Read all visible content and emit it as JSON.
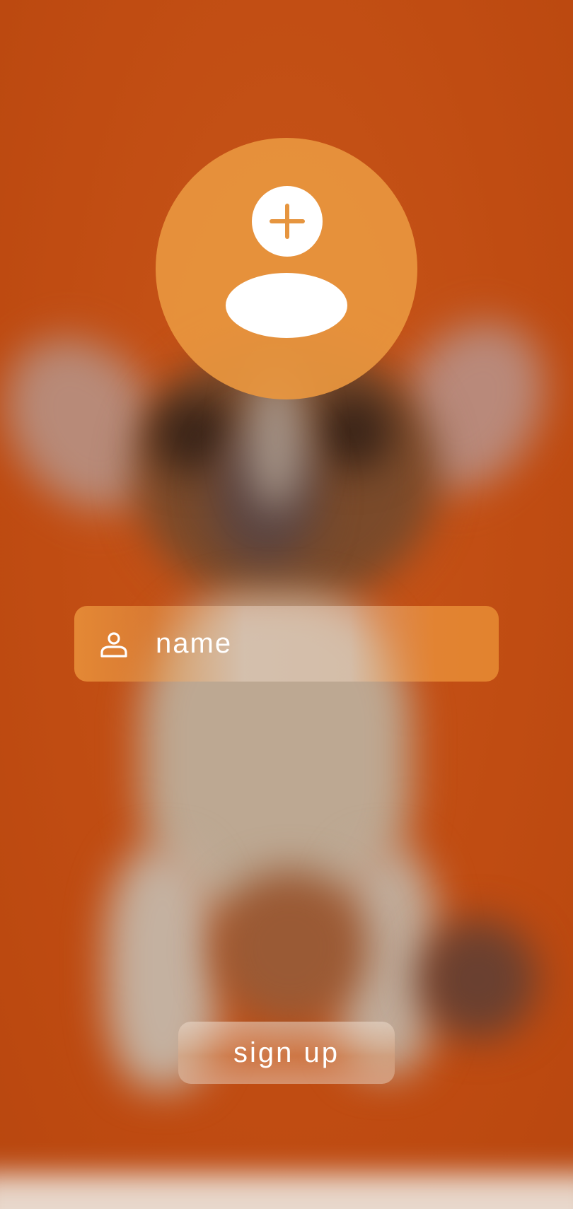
{
  "avatar": {
    "icon": "add-user-icon"
  },
  "name_field": {
    "icon": "person-icon",
    "placeholder": "name",
    "value": ""
  },
  "signup": {
    "label": "sign up"
  },
  "colors": {
    "background": "#c24f13",
    "accent": "#e6953f",
    "foreground": "#ffffff"
  }
}
